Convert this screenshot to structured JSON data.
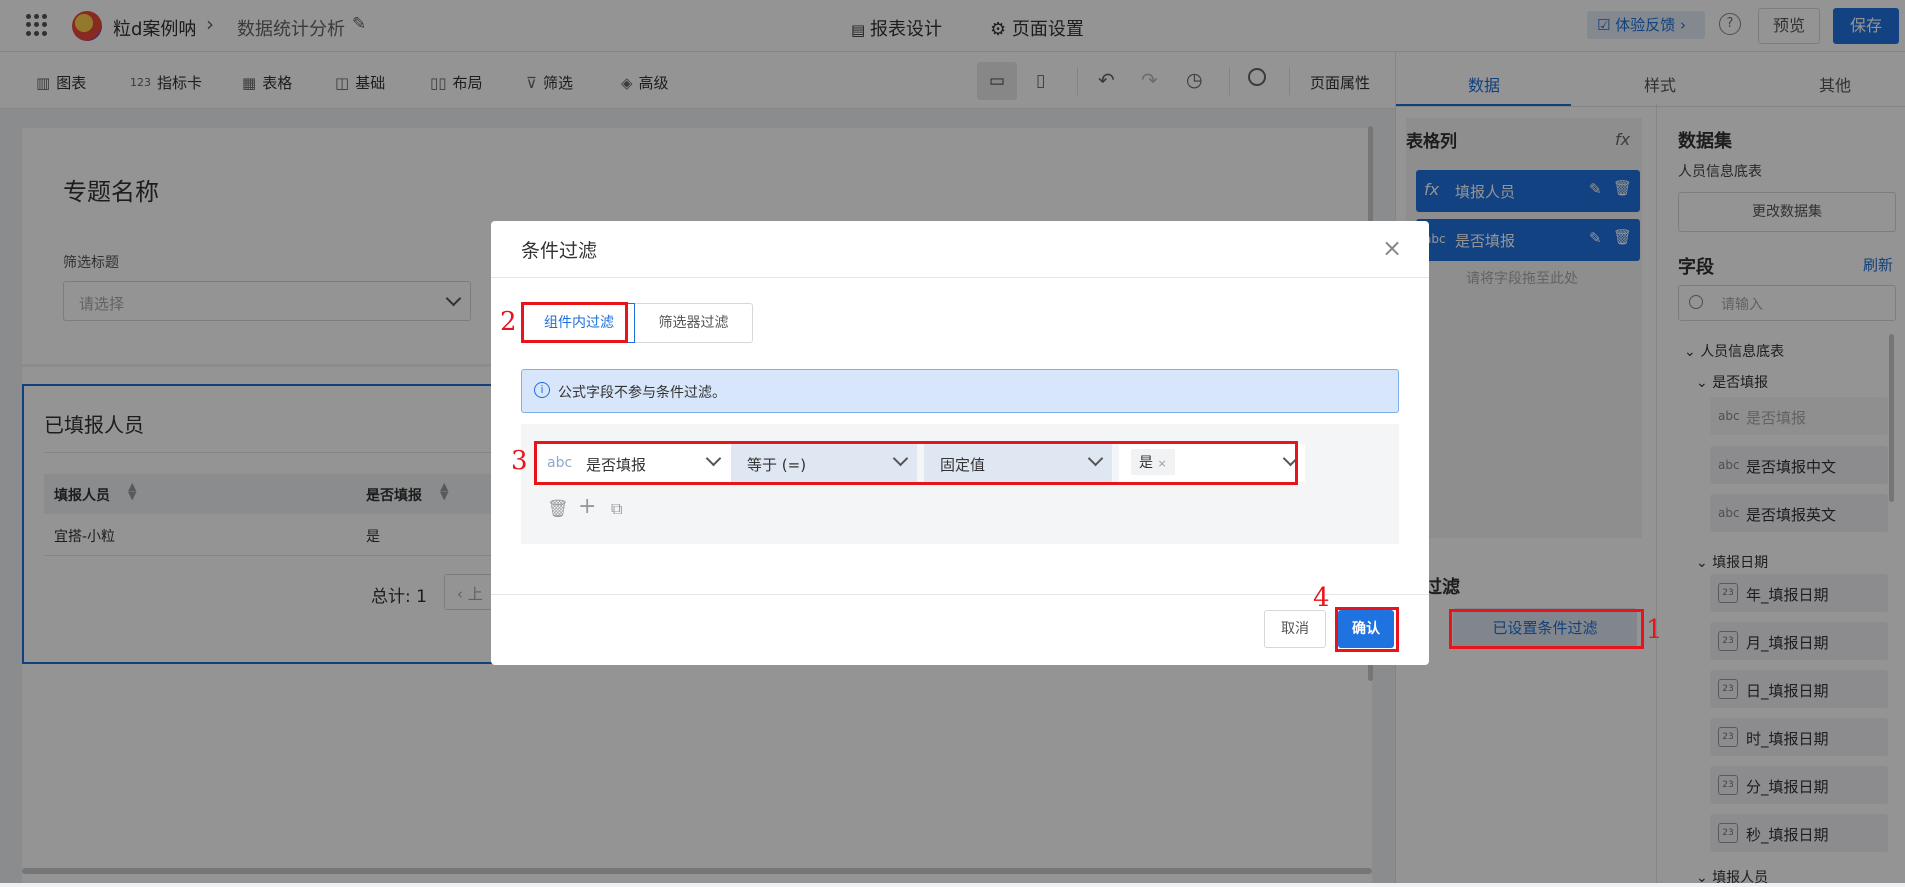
{
  "topbar": {
    "app_name": "粒d案例呐",
    "breadcrumb_current": "数据统计分析",
    "tabs": [
      {
        "label": "报表设计"
      },
      {
        "label": "页面设置"
      }
    ],
    "feedback_label": "体验反馈",
    "preview_label": "预览",
    "save_label": "保存"
  },
  "toolbar": {
    "items": [
      {
        "label": "图表",
        "icon": "bar-chart-icon"
      },
      {
        "label": "指标卡",
        "icon": "metric-card-icon"
      },
      {
        "label": "表格",
        "icon": "table-icon"
      },
      {
        "label": "基础",
        "icon": "basic-grid-icon"
      },
      {
        "label": "布局",
        "icon": "layout-icon"
      },
      {
        "label": "筛选",
        "icon": "filter-icon"
      },
      {
        "label": "高级",
        "icon": "layers-icon"
      }
    ],
    "page_props_label": "页面属性"
  },
  "canvas": {
    "topic_title": "专题名称",
    "filter_label": "筛选标题",
    "filter_placeholder": "请选择",
    "table_title": "已填报人员",
    "columns": [
      "填报人员",
      "是否填报"
    ],
    "rows": [
      [
        "宜搭-小粒",
        "是"
      ]
    ],
    "total_label": "总计: 1",
    "prev_label": "上"
  },
  "right_panel": {
    "tabs": [
      {
        "label": "数据"
      },
      {
        "label": "样式"
      },
      {
        "label": "其他"
      }
    ],
    "table_cols_title": "表格列",
    "table_cols": [
      {
        "prefix": "fx",
        "label": "填报人员"
      },
      {
        "prefix": "abc",
        "label": "是否填报"
      }
    ],
    "drop_hint": "请将字段拖至此处",
    "filter_section_title": "件过滤",
    "filter_set_label": "已设置条件过滤",
    "dataset_title": "数据集",
    "dataset_name": "人员信息底表",
    "change_dataset_label": "更改数据集",
    "fields_title": "字段",
    "refresh_label": "刷新",
    "search_placeholder": "请输入",
    "tree_root": "人员信息底表",
    "group1": "是否填报",
    "group1_fields": [
      "是否填报",
      "是否填报中文",
      "是否填报英文"
    ],
    "group2": "填报日期",
    "group2_fields": [
      "年_填报日期",
      "月_填报日期",
      "日_填报日期",
      "时_填报日期",
      "分_填报日期",
      "秒_填报日期"
    ],
    "group3": "填报人员"
  },
  "modal": {
    "title": "条件过滤",
    "tab_inner": "组件内过滤",
    "tab_filter": "筛选器过滤",
    "info_text": "公式字段不参与条件过滤。",
    "field_type": "abc",
    "field_value": "是否填报",
    "operator_value": "等于 (=)",
    "value_type": "固定值",
    "tag_value": "是",
    "cancel_label": "取消",
    "confirm_label": "确认"
  },
  "annotations": {
    "n1": "1",
    "n2": "2",
    "n3": "3",
    "n4": "4",
    "color": "#e8141b"
  },
  "colors": {
    "accent": "#1f73e0",
    "selected_bg": "#dfe7f3"
  }
}
